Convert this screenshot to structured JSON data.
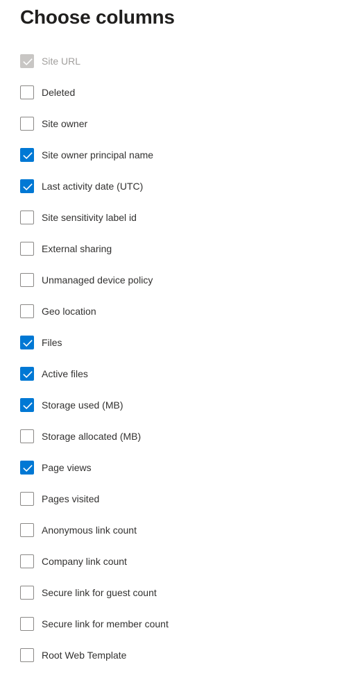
{
  "panel": {
    "title": "Choose columns",
    "accent_color": "#0078d4",
    "disabled_color": "#c8c6c4",
    "text_color": "#323130",
    "disabled_text_color": "#a19f9d",
    "title_color": "#201f1e",
    "background": "#ffffff",
    "checkbox_border_color": "#8a8886"
  },
  "columns": [
    {
      "label": "Site URL",
      "checked": true,
      "disabled": true,
      "icon": "checkmark-icon"
    },
    {
      "label": "Deleted",
      "checked": false,
      "disabled": false,
      "icon": "checkmark-icon"
    },
    {
      "label": "Site owner",
      "checked": false,
      "disabled": false,
      "icon": "checkmark-icon"
    },
    {
      "label": "Site owner principal name",
      "checked": true,
      "disabled": false,
      "icon": "checkmark-icon"
    },
    {
      "label": "Last activity date (UTC)",
      "checked": true,
      "disabled": false,
      "icon": "checkmark-icon"
    },
    {
      "label": "Site sensitivity label id",
      "checked": false,
      "disabled": false,
      "icon": "checkmark-icon"
    },
    {
      "label": "External sharing",
      "checked": false,
      "disabled": false,
      "icon": "checkmark-icon"
    },
    {
      "label": "Unmanaged device policy",
      "checked": false,
      "disabled": false,
      "icon": "checkmark-icon"
    },
    {
      "label": "Geo location",
      "checked": false,
      "disabled": false,
      "icon": "checkmark-icon"
    },
    {
      "label": "Files",
      "checked": true,
      "disabled": false,
      "icon": "checkmark-icon"
    },
    {
      "label": "Active files",
      "checked": true,
      "disabled": false,
      "icon": "checkmark-icon"
    },
    {
      "label": "Storage used (MB)",
      "checked": true,
      "disabled": false,
      "icon": "checkmark-icon"
    },
    {
      "label": "Storage allocated (MB)",
      "checked": false,
      "disabled": false,
      "icon": "checkmark-icon"
    },
    {
      "label": "Page views",
      "checked": true,
      "disabled": false,
      "icon": "checkmark-icon"
    },
    {
      "label": "Pages visited",
      "checked": false,
      "disabled": false,
      "icon": "checkmark-icon"
    },
    {
      "label": "Anonymous link count",
      "checked": false,
      "disabled": false,
      "icon": "checkmark-icon"
    },
    {
      "label": "Company link count",
      "checked": false,
      "disabled": false,
      "icon": "checkmark-icon"
    },
    {
      "label": "Secure link for guest count",
      "checked": false,
      "disabled": false,
      "icon": "checkmark-icon"
    },
    {
      "label": "Secure link for member count",
      "checked": false,
      "disabled": false,
      "icon": "checkmark-icon"
    },
    {
      "label": "Root Web Template",
      "checked": false,
      "disabled": false,
      "icon": "checkmark-icon"
    }
  ]
}
